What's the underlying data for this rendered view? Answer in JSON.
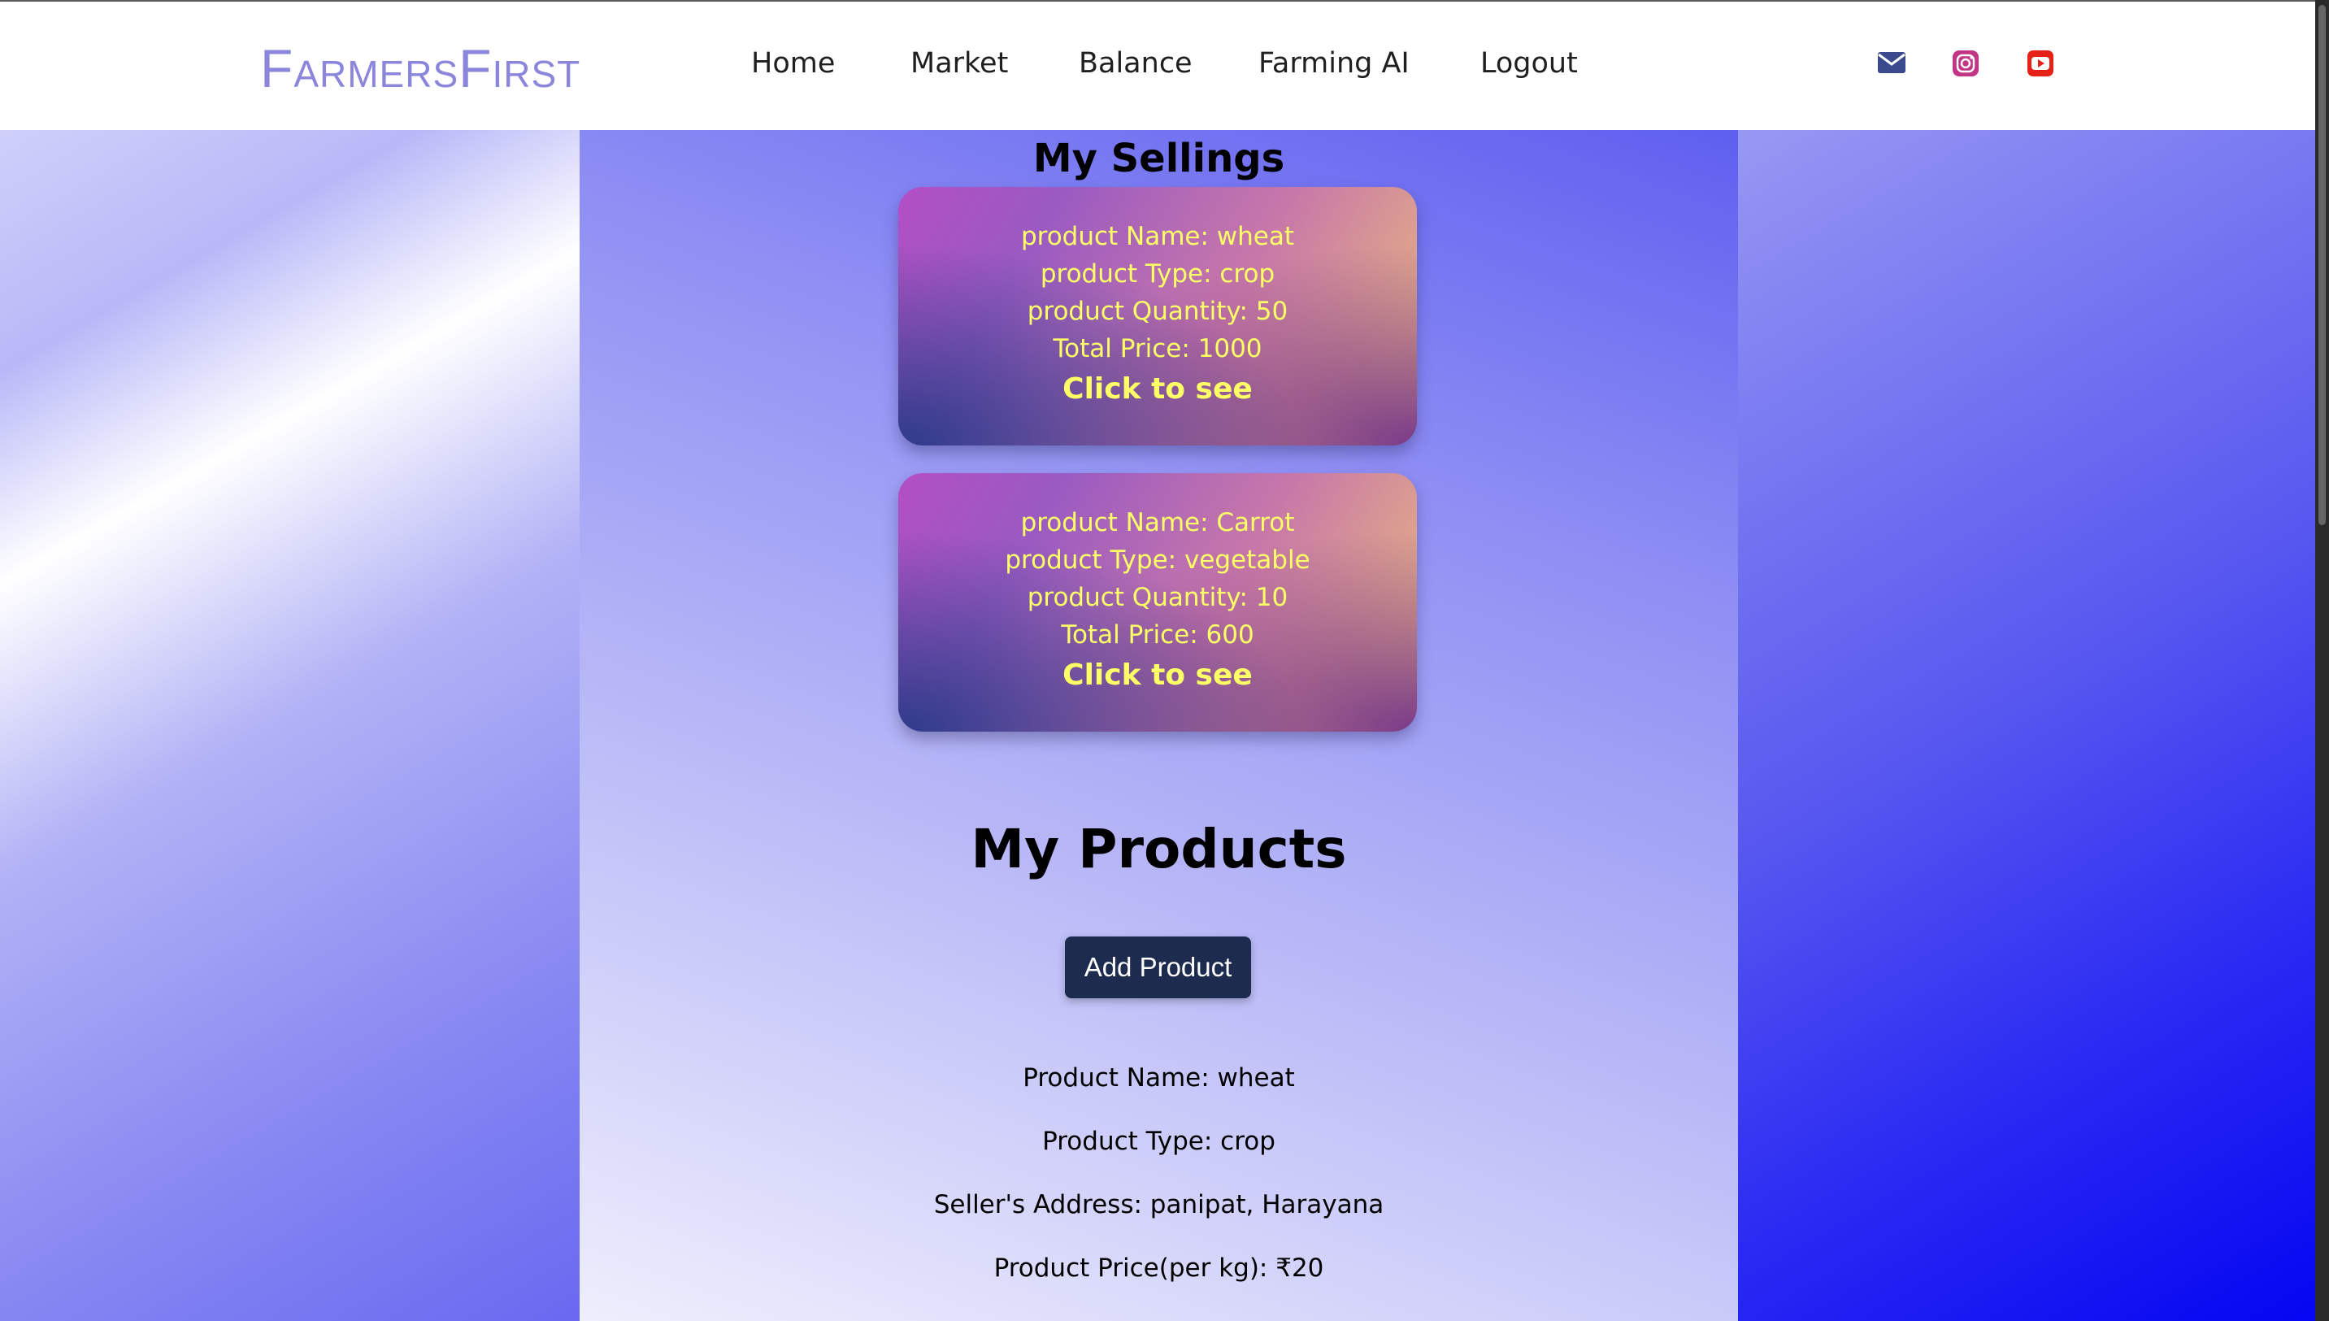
{
  "header": {
    "logo": {
      "first_big": "F",
      "first_rest": "armers",
      "second_big": "F",
      "second_rest": "irst"
    },
    "nav": [
      "Home",
      "Market",
      "Balance",
      "Farming AI",
      "Logout"
    ],
    "social": [
      {
        "icon": "mail-icon",
        "color": "#3b4a8c"
      },
      {
        "icon": "instagram-icon",
        "color": "#c13584"
      },
      {
        "icon": "youtube-icon",
        "color": "#e62117"
      }
    ]
  },
  "sellings": {
    "title": "My Sellings",
    "cards": [
      {
        "name": "product Name: wheat",
        "type": "product Type: crop",
        "quantity": "product Quantity: 50",
        "price": "Total Price: 1000",
        "cta": "Click to see"
      },
      {
        "name": "product Name: Carrot",
        "type": "product Type: vegetable",
        "quantity": "product Quantity: 10",
        "price": "Total Price: 600",
        "cta": "Click to see"
      }
    ]
  },
  "products": {
    "title": "My Products",
    "add_button": "Add Product",
    "details": {
      "name": "Product Name: wheat",
      "type": "Product Type: crop",
      "address": "Seller's Address: panipat, Harayana",
      "price": "Product Price(per kg): ₹20"
    }
  },
  "colors": {
    "card_text": "#ffff66",
    "button_bg": "#1d2b4e",
    "logo": "#8b86dc"
  }
}
